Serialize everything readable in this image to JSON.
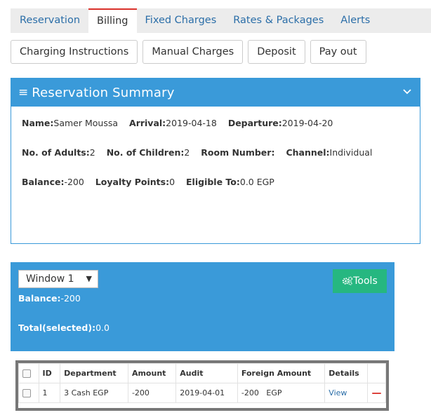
{
  "tabs": [
    {
      "label": "Reservation",
      "active": false
    },
    {
      "label": "Billing",
      "active": true
    },
    {
      "label": "Fixed Charges",
      "active": false
    },
    {
      "label": "Rates & Packages",
      "active": false
    },
    {
      "label": "Alerts",
      "active": false
    }
  ],
  "subbuttons": [
    "Charging Instructions",
    "Manual Charges",
    "Deposit",
    "Pay out"
  ],
  "summary": {
    "title": "Reservation Summary",
    "menu_icon": "hamburger-icon",
    "toggle_icon": "chevron-down-icon",
    "name_label": "Name:",
    "name_value": "Samer Moussa",
    "arrival_label": "Arrival:",
    "arrival_value": "2019-04-18",
    "departure_label": "Departure:",
    "departure_value": "2019-04-20",
    "adults_label": "No. of Adults:",
    "adults_value": "2",
    "children_label": "No. of Children:",
    "children_value": "2",
    "room_label": "Room Number:",
    "room_value": "",
    "channel_label": "Channel:",
    "channel_value": "Individual",
    "balance_label": "Balance:",
    "balance_value": "-200",
    "loyalty_label": "Loyalty Points:",
    "loyalty_value": "0",
    "eligible_label": "Eligible To:",
    "eligible_value": "0.0 EGP"
  },
  "window": {
    "select_value": "Window 1",
    "tools_label": "Tools",
    "tools_icon": "gears-icon",
    "balance_label": "Balance:",
    "balance_value": "-200",
    "total_label": "Total(selected):",
    "total_value": "0.0"
  },
  "table": {
    "headers": [
      "",
      "ID",
      "Department",
      "Amount",
      "Audit",
      "Foreign Amount",
      "Details",
      ""
    ],
    "rows": [
      {
        "id": "1",
        "department": "3 Cash EGP",
        "amount": "-200",
        "audit": "2019-04-01",
        "foreign_amount": "-200",
        "foreign_currency": "EGP",
        "details": "View",
        "action_icon": "minus-icon"
      }
    ]
  },
  "colors": {
    "primary": "#3a9ad9",
    "tools": "#26b780",
    "link": "#2b6ea8",
    "active_tab_border": "#d9302a"
  }
}
